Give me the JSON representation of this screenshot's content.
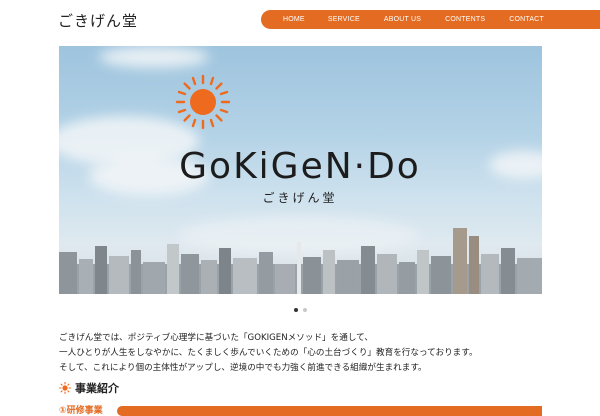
{
  "header": {
    "logo_text": "ごきげん堂",
    "nav": [
      "HOME",
      "SERVICE",
      "ABOUT US",
      "CONTENTS",
      "CONTACT"
    ]
  },
  "hero": {
    "brand": "GoKiGeN·Do",
    "brand_sub": "ごきげん堂"
  },
  "carousel": {
    "count": 2,
    "active": 1
  },
  "intro": {
    "lines": [
      "ごきげん堂では、ポジティブ心理学に基づいた「GOKIGENメソッド」を通して、",
      "一人ひとりが人生をしなやかに、たくましく歩んでいくための「心の土台づくり」教育を行なっております。",
      "そして、これにより個の主体性がアップし、逆境の中でも力強く前進できる組織が生まれます。"
    ]
  },
  "section": {
    "title": "事業紹介",
    "sub_label": "①研修事業"
  },
  "colors": {
    "accent": "#e36b22",
    "sun": "#ee6a1f"
  }
}
